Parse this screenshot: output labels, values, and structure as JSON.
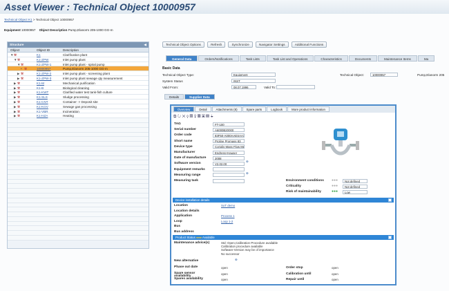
{
  "app": {
    "title": "Asset Viewer : Technical Object 10000957"
  },
  "breadcrumb": {
    "link": "Technical Object K1",
    "sep": ">",
    "current": "Technical Object 10000957"
  },
  "equipment": {
    "label": "Equipment",
    "value": "10000957",
    "desc_label": "Object Description",
    "desc_value": "Pump,Elanorm 205-1000 GG-m"
  },
  "structure": {
    "title": "Structure",
    "columns": [
      "Object",
      "Object ID",
      "Description"
    ],
    "rows": [
      {
        "indent": 0,
        "arrow": "▼",
        "id": "K1",
        "desc": "Clarification plant",
        "sel": false
      },
      {
        "indent": 1,
        "arrow": "▼",
        "id": "K1-ZPW",
        "desc": "Inlet pump plant",
        "sel": false
      },
      {
        "indent": 2,
        "arrow": "▼",
        "id": "K1-ZPW-1",
        "desc": "Inlet pump plant - spiral pump",
        "sel": false
      },
      {
        "indent": 3,
        "arrow": "•",
        "id": "10000957",
        "desc": "Pump,Elanorm 205-1000 GG-m",
        "sel": true
      },
      {
        "indent": 2,
        "arrow": "▶",
        "id": "K1-ZPW-2",
        "desc": "Inlet pump plant - screening plant",
        "sel": false
      },
      {
        "indent": 2,
        "arrow": "▶",
        "id": "K1-ZPW-3",
        "desc": "Inlet pump plant sewage qty measurement",
        "sel": false
      },
      {
        "indent": 1,
        "arrow": "▶",
        "id": "K1-M",
        "desc": "Mechanical purification",
        "sel": false
      },
      {
        "indent": 1,
        "arrow": "▶",
        "id": "K1-B",
        "desc": "Biological cleaning",
        "sel": false
      },
      {
        "indent": 1,
        "arrow": "▶",
        "id": "K1-KWT",
        "desc": "Clarified water test tank-fish culture",
        "sel": false
      },
      {
        "indent": 1,
        "arrow": "▶",
        "id": "K1-SLS",
        "desc": "Sludge processing",
        "sel": false
      },
      {
        "indent": 1,
        "arrow": "▶",
        "id": "K1-CNT",
        "desc": "Container -> Deposit site",
        "sel": false
      },
      {
        "indent": 1,
        "arrow": "▶",
        "id": "K1-KGV",
        "desc": "Sewage gas processing",
        "sel": false
      },
      {
        "indent": 1,
        "arrow": "▶",
        "id": "K1-VBR",
        "desc": "Incineration",
        "sel": false
      },
      {
        "indent": 1,
        "arrow": "▶",
        "id": "K1-HZA",
        "desc": "Heating",
        "sel": false
      }
    ]
  },
  "buttons": [
    "Technical Object Options",
    "Refresh",
    "Synchronize",
    "Navigator Settings",
    "Additional Functions"
  ],
  "tabs": [
    "General Data",
    "Orders/Notifications",
    "Task Lists",
    "Task List and Operations",
    "Characteristics",
    "Documents",
    "Maintenance Items",
    "Ma"
  ],
  "basic": {
    "title": "Basic Data",
    "type_label": "Technical Object Type:",
    "type_value": "Equipment",
    "status_label": "System Status",
    "status_value": "INST",
    "valid_label": "Valid From:",
    "valid_value": "08.07.1996",
    "valid_to_label": "Valid To:",
    "tech_label": "Technical Object:",
    "tech_value": "10000957",
    "tech_desc": "Pump,Elanorm 205"
  },
  "subtabs": [
    "Details",
    "Supplier Data"
  ],
  "win_tabs": [
    "Overview",
    "Detail",
    "Attachments (8)",
    "Spare parts",
    "Logbook",
    "More product information"
  ],
  "fields": [
    {
      "label": "TAG",
      "value": "FT-100"
    },
    {
      "label": "Serial number",
      "value": "A6000B20000"
    },
    {
      "label": "Order code",
      "value": "83F50-A000AAESAAXX"
    },
    {
      "label": "Short name",
      "value": "Proline Promass 83"
    },
    {
      "label": "Device type",
      "value": "Coriolis Mass Flow Measurem"
    },
    {
      "label": "Manufacturer",
      "value": "Endress+Hauser"
    },
    {
      "label": "Date of manufacture",
      "value": "2008"
    },
    {
      "label": "Software version",
      "value": "V2.02.00"
    },
    {
      "label": "Equipment remarks",
      "value": ""
    },
    {
      "label": "Measuring range",
      "value": ""
    },
    {
      "label": "Measuring task",
      "value": ""
    }
  ],
  "right_fields": [
    {
      "label": "Environment conditions",
      "value": "Not defined"
    },
    {
      "label": "Criticality",
      "value": "Not defined"
    },
    {
      "label": "Risk of maintainability",
      "value": "Low"
    }
  ],
  "install_bar": "Device installation details",
  "install": [
    {
      "label": "Location",
      "value": "SoT demo",
      "link": true
    },
    {
      "label": "Location details",
      "value": "",
      "link": false
    },
    {
      "label": "Application",
      "value": "Process 1",
      "link": true
    },
    {
      "label": "Loop",
      "value": "Loop 1-2",
      "link": true
    },
    {
      "label": "Bus",
      "value": "",
      "link": false
    },
    {
      "label": "Bus address",
      "value": "",
      "link": false
    }
  ],
  "status_bar": {
    "label": "Product Status",
    "value": "Available"
  },
  "maintenance": {
    "label": "Maintenance advice(s)",
    "lines": [
      "Std: Open,Calibration Procedure available",
      "Calibration procedure available",
      "Software-Version may be of importance",
      "No successor"
    ]
  },
  "new_alt": {
    "label": "New alternative"
  },
  "bottom": [
    {
      "l": "Phase out date",
      "v": "open",
      "l2": "Order stop",
      "v2": "open"
    },
    {
      "l": "Spare sensor availability",
      "v": "open",
      "l2": "Calibration until",
      "v2": "open"
    },
    {
      "l": "Spares availability",
      "v": "open",
      "l2": "Repair until",
      "v2": "open"
    }
  ],
  "colors": {
    "accent": "#3f82c8",
    "selected": "#f3a73b",
    "title": "#2a4b75"
  }
}
